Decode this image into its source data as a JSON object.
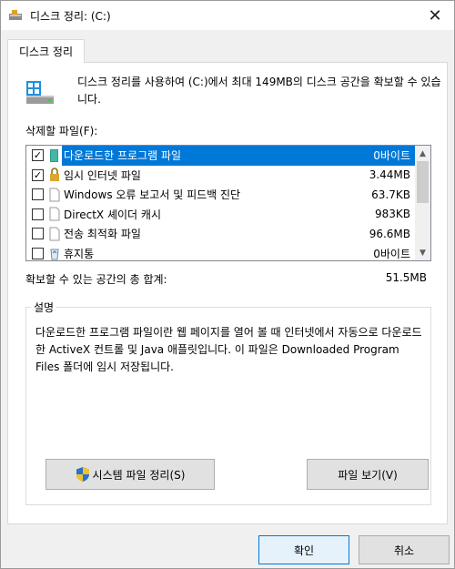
{
  "window": {
    "title": "디스크 정리: (C:)",
    "close_glyph": "✕"
  },
  "tab": {
    "label": "디스크 정리"
  },
  "intro": {
    "text": "디스크 정리를 사용하여 (C:)에서 최대 149MB의 디스크 공간을 확보할 수 있습니다."
  },
  "files": {
    "label": "삭제할 파일(F):",
    "items": [
      {
        "name": "다운로드한 프로그램 파일",
        "size": "0바이트",
        "checked": true,
        "selected": true,
        "icon": "folder-icon"
      },
      {
        "name": "임시 인터넷 파일",
        "size": "3.44MB",
        "checked": true,
        "selected": false,
        "icon": "lock-icon"
      },
      {
        "name": "Windows 오류 보고서 및 피드백 진단",
        "size": "63.7KB",
        "checked": false,
        "selected": false,
        "icon": "file-icon"
      },
      {
        "name": "DirectX 셰이더 캐시",
        "size": "983KB",
        "checked": false,
        "selected": false,
        "icon": "file-icon"
      },
      {
        "name": "전송 최적화 파일",
        "size": "96.6MB",
        "checked": false,
        "selected": false,
        "icon": "file-icon"
      },
      {
        "name": "휴지통",
        "size": "0바이트",
        "checked": false,
        "selected": false,
        "icon": "recycle-bin-icon"
      }
    ],
    "check_glyph": "✓"
  },
  "total": {
    "label": "확보할 수 있는 공간의 총 합계:",
    "value": "51.5MB"
  },
  "description": {
    "legend": "설명",
    "text": "다운로드한 프로그램 파일이란 웹 페이지를 열어 볼 때 인터넷에서 자동으로 다운로드한 ActiveX 컨트롤 및 Java 애플릿입니다. 이 파일은 Downloaded Program Files 폴더에 임시 저장됩니다."
  },
  "buttons": {
    "system_cleanup": "시스템 파일 정리(S)",
    "view_files": "파일 보기(V)",
    "ok": "확인",
    "cancel": "취소"
  },
  "scroll": {
    "up": "▲",
    "down": "▼"
  },
  "colors": {
    "selection": "#0078d7",
    "accent_border": "#0078d7"
  }
}
